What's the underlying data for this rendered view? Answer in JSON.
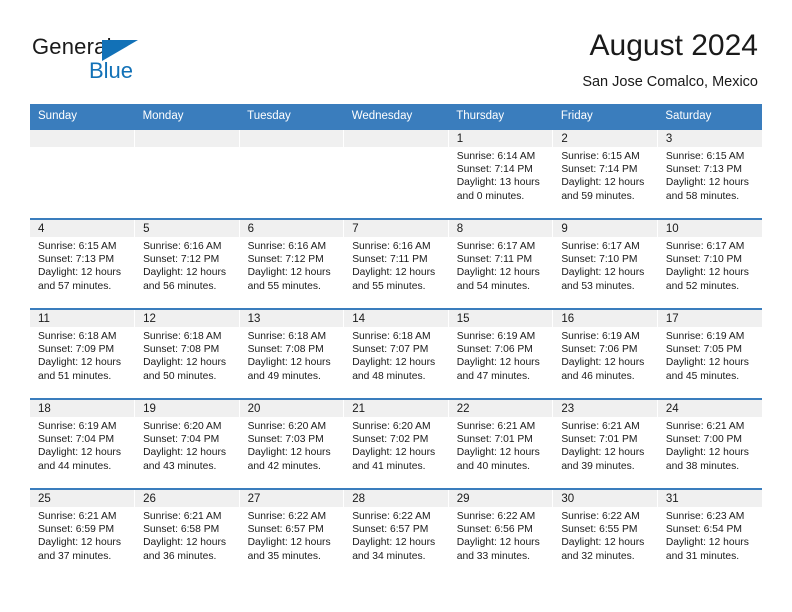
{
  "logo": {
    "word_top": "General",
    "word_bottom": "Blue",
    "triangle_color": "#1271b7",
    "icon": "triangle-icon"
  },
  "header": {
    "title": "August 2024",
    "subtitle": "San Jose Comalco, Mexico"
  },
  "colors": {
    "header_blue": "#3a7dbd",
    "daynum_background": "#f0f0f0",
    "text": "#1a1a1a",
    "brand_blue": "#1271b7"
  },
  "weekday_headers": [
    "Sunday",
    "Monday",
    "Tuesday",
    "Wednesday",
    "Thursday",
    "Friday",
    "Saturday"
  ],
  "labels": {
    "sunrise_prefix": "Sunrise:",
    "sunset_prefix": "Sunset:",
    "daylight_prefix": "Daylight:"
  },
  "weeks": [
    [
      {
        "day": "",
        "sunrise": "",
        "sunset": "",
        "daylight": "",
        "empty": true
      },
      {
        "day": "",
        "sunrise": "",
        "sunset": "",
        "daylight": "",
        "empty": true
      },
      {
        "day": "",
        "sunrise": "",
        "sunset": "",
        "daylight": "",
        "empty": true
      },
      {
        "day": "",
        "sunrise": "",
        "sunset": "",
        "daylight": "",
        "empty": true
      },
      {
        "day": "1",
        "sunrise": "Sunrise: 6:14 AM",
        "sunset": "Sunset: 7:14 PM",
        "daylight": "Daylight: 13 hours and 0 minutes.",
        "empty": false
      },
      {
        "day": "2",
        "sunrise": "Sunrise: 6:15 AM",
        "sunset": "Sunset: 7:14 PM",
        "daylight": "Daylight: 12 hours and 59 minutes.",
        "empty": false
      },
      {
        "day": "3",
        "sunrise": "Sunrise: 6:15 AM",
        "sunset": "Sunset: 7:13 PM",
        "daylight": "Daylight: 12 hours and 58 minutes.",
        "empty": false
      }
    ],
    [
      {
        "day": "4",
        "sunrise": "Sunrise: 6:15 AM",
        "sunset": "Sunset: 7:13 PM",
        "daylight": "Daylight: 12 hours and 57 minutes.",
        "empty": false
      },
      {
        "day": "5",
        "sunrise": "Sunrise: 6:16 AM",
        "sunset": "Sunset: 7:12 PM",
        "daylight": "Daylight: 12 hours and 56 minutes.",
        "empty": false
      },
      {
        "day": "6",
        "sunrise": "Sunrise: 6:16 AM",
        "sunset": "Sunset: 7:12 PM",
        "daylight": "Daylight: 12 hours and 55 minutes.",
        "empty": false
      },
      {
        "day": "7",
        "sunrise": "Sunrise: 6:16 AM",
        "sunset": "Sunset: 7:11 PM",
        "daylight": "Daylight: 12 hours and 55 minutes.",
        "empty": false
      },
      {
        "day": "8",
        "sunrise": "Sunrise: 6:17 AM",
        "sunset": "Sunset: 7:11 PM",
        "daylight": "Daylight: 12 hours and 54 minutes.",
        "empty": false
      },
      {
        "day": "9",
        "sunrise": "Sunrise: 6:17 AM",
        "sunset": "Sunset: 7:10 PM",
        "daylight": "Daylight: 12 hours and 53 minutes.",
        "empty": false
      },
      {
        "day": "10",
        "sunrise": "Sunrise: 6:17 AM",
        "sunset": "Sunset: 7:10 PM",
        "daylight": "Daylight: 12 hours and 52 minutes.",
        "empty": false
      }
    ],
    [
      {
        "day": "11",
        "sunrise": "Sunrise: 6:18 AM",
        "sunset": "Sunset: 7:09 PM",
        "daylight": "Daylight: 12 hours and 51 minutes.",
        "empty": false
      },
      {
        "day": "12",
        "sunrise": "Sunrise: 6:18 AM",
        "sunset": "Sunset: 7:08 PM",
        "daylight": "Daylight: 12 hours and 50 minutes.",
        "empty": false
      },
      {
        "day": "13",
        "sunrise": "Sunrise: 6:18 AM",
        "sunset": "Sunset: 7:08 PM",
        "daylight": "Daylight: 12 hours and 49 minutes.",
        "empty": false
      },
      {
        "day": "14",
        "sunrise": "Sunrise: 6:18 AM",
        "sunset": "Sunset: 7:07 PM",
        "daylight": "Daylight: 12 hours and 48 minutes.",
        "empty": false
      },
      {
        "day": "15",
        "sunrise": "Sunrise: 6:19 AM",
        "sunset": "Sunset: 7:06 PM",
        "daylight": "Daylight: 12 hours and 47 minutes.",
        "empty": false
      },
      {
        "day": "16",
        "sunrise": "Sunrise: 6:19 AM",
        "sunset": "Sunset: 7:06 PM",
        "daylight": "Daylight: 12 hours and 46 minutes.",
        "empty": false
      },
      {
        "day": "17",
        "sunrise": "Sunrise: 6:19 AM",
        "sunset": "Sunset: 7:05 PM",
        "daylight": "Daylight: 12 hours and 45 minutes.",
        "empty": false
      }
    ],
    [
      {
        "day": "18",
        "sunrise": "Sunrise: 6:19 AM",
        "sunset": "Sunset: 7:04 PM",
        "daylight": "Daylight: 12 hours and 44 minutes.",
        "empty": false
      },
      {
        "day": "19",
        "sunrise": "Sunrise: 6:20 AM",
        "sunset": "Sunset: 7:04 PM",
        "daylight": "Daylight: 12 hours and 43 minutes.",
        "empty": false
      },
      {
        "day": "20",
        "sunrise": "Sunrise: 6:20 AM",
        "sunset": "Sunset: 7:03 PM",
        "daylight": "Daylight: 12 hours and 42 minutes.",
        "empty": false
      },
      {
        "day": "21",
        "sunrise": "Sunrise: 6:20 AM",
        "sunset": "Sunset: 7:02 PM",
        "daylight": "Daylight: 12 hours and 41 minutes.",
        "empty": false
      },
      {
        "day": "22",
        "sunrise": "Sunrise: 6:21 AM",
        "sunset": "Sunset: 7:01 PM",
        "daylight": "Daylight: 12 hours and 40 minutes.",
        "empty": false
      },
      {
        "day": "23",
        "sunrise": "Sunrise: 6:21 AM",
        "sunset": "Sunset: 7:01 PM",
        "daylight": "Daylight: 12 hours and 39 minutes.",
        "empty": false
      },
      {
        "day": "24",
        "sunrise": "Sunrise: 6:21 AM",
        "sunset": "Sunset: 7:00 PM",
        "daylight": "Daylight: 12 hours and 38 minutes.",
        "empty": false
      }
    ],
    [
      {
        "day": "25",
        "sunrise": "Sunrise: 6:21 AM",
        "sunset": "Sunset: 6:59 PM",
        "daylight": "Daylight: 12 hours and 37 minutes.",
        "empty": false
      },
      {
        "day": "26",
        "sunrise": "Sunrise: 6:21 AM",
        "sunset": "Sunset: 6:58 PM",
        "daylight": "Daylight: 12 hours and 36 minutes.",
        "empty": false
      },
      {
        "day": "27",
        "sunrise": "Sunrise: 6:22 AM",
        "sunset": "Sunset: 6:57 PM",
        "daylight": "Daylight: 12 hours and 35 minutes.",
        "empty": false
      },
      {
        "day": "28",
        "sunrise": "Sunrise: 6:22 AM",
        "sunset": "Sunset: 6:57 PM",
        "daylight": "Daylight: 12 hours and 34 minutes.",
        "empty": false
      },
      {
        "day": "29",
        "sunrise": "Sunrise: 6:22 AM",
        "sunset": "Sunset: 6:56 PM",
        "daylight": "Daylight: 12 hours and 33 minutes.",
        "empty": false
      },
      {
        "day": "30",
        "sunrise": "Sunrise: 6:22 AM",
        "sunset": "Sunset: 6:55 PM",
        "daylight": "Daylight: 12 hours and 32 minutes.",
        "empty": false
      },
      {
        "day": "31",
        "sunrise": "Sunrise: 6:23 AM",
        "sunset": "Sunset: 6:54 PM",
        "daylight": "Daylight: 12 hours and 31 minutes.",
        "empty": false
      }
    ]
  ]
}
